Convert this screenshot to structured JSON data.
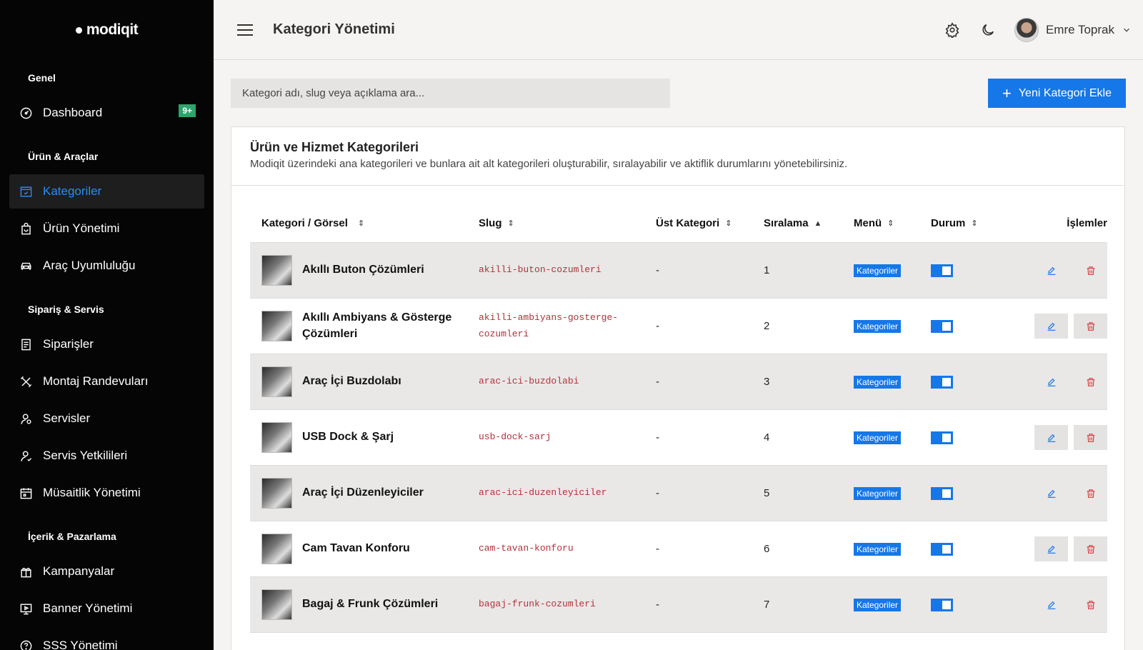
{
  "sidebar": {
    "logo": "modiqit",
    "sections": [
      {
        "title": "Genel",
        "items": [
          {
            "label": "Dashboard",
            "icon": "dashboard-icon",
            "badge": "9+"
          }
        ]
      },
      {
        "title": "Ürün & Araçlar",
        "items": [
          {
            "label": "Kategoriler",
            "icon": "category-icon",
            "active": true
          },
          {
            "label": "Ürün Yönetimi",
            "icon": "bag-icon"
          },
          {
            "label": "Araç Uyumluluğu",
            "icon": "car-icon"
          }
        ]
      },
      {
        "title": "Sipariş & Servis",
        "items": [
          {
            "label": "Siparişler",
            "icon": "orders-icon"
          },
          {
            "label": "Montaj Randevuları",
            "icon": "tools-icon"
          },
          {
            "label": "Servisler",
            "icon": "user-pin-icon"
          },
          {
            "label": "Servis Yetkilileri",
            "icon": "user-check-icon"
          },
          {
            "label": "Müsaitlik Yönetimi",
            "icon": "calendar-icon"
          }
        ]
      },
      {
        "title": "İçerik & Pazarlama",
        "items": [
          {
            "label": "Kampanyalar",
            "icon": "gift-icon"
          },
          {
            "label": "Banner Yönetimi",
            "icon": "monitor-icon"
          },
          {
            "label": "SSS Yönetimi",
            "icon": "help-icon"
          }
        ]
      }
    ]
  },
  "header": {
    "title": "Kategori Yönetimi",
    "user_name": "Emre Toprak"
  },
  "search": {
    "placeholder": "Kategori adı, slug veya açıklama ara..."
  },
  "add_button": "Yeni Kategori Ekle",
  "card": {
    "title": "Ürün ve Hizmet Kategorileri",
    "description": "Modiqit üzerindeki ana kategorileri ve bunlara ait alt kategorileri oluşturabilir, sıralayabilir ve aktiflik durumlarını yönetebilirsiniz."
  },
  "table": {
    "headers": {
      "category": "Kategori / Görsel",
      "slug": "Slug",
      "parent": "Üst Kategori",
      "order": "Sıralama",
      "menu": "Menü",
      "status": "Durum",
      "actions": "İşlemler"
    },
    "rows": [
      {
        "name": "Akıllı Buton Çözümleri",
        "slug": "akilli-buton-cozumleri",
        "parent": "-",
        "order": "1",
        "menu": "Kategoriler"
      },
      {
        "name": "Akıllı Ambiyans & Gösterge Çözümleri",
        "slug": "akilli-ambiyans-gosterge-cozumleri",
        "parent": "-",
        "order": "2",
        "menu": "Kategoriler"
      },
      {
        "name": "Araç İçi Buzdolabı",
        "slug": "arac-ici-buzdolabi",
        "parent": "-",
        "order": "3",
        "menu": "Kategoriler"
      },
      {
        "name": "USB Dock & Şarj",
        "slug": "usb-dock-sarj",
        "parent": "-",
        "order": "4",
        "menu": "Kategoriler"
      },
      {
        "name": "Araç İçi Düzenleyiciler",
        "slug": "arac-ici-duzenleyiciler",
        "parent": "-",
        "order": "5",
        "menu": "Kategoriler"
      },
      {
        "name": "Cam Tavan Konforu",
        "slug": "cam-tavan-konforu",
        "parent": "-",
        "order": "6",
        "menu": "Kategoriler"
      },
      {
        "name": "Bagaj & Frunk Çözümleri",
        "slug": "bagaj-frunk-cozumleri",
        "parent": "-",
        "order": "7",
        "menu": "Kategoriler"
      }
    ]
  },
  "colors": {
    "accent": "#1677e8",
    "slug": "#b5303a",
    "delete": "#e0383e",
    "badge_green": "#2fa36b"
  }
}
